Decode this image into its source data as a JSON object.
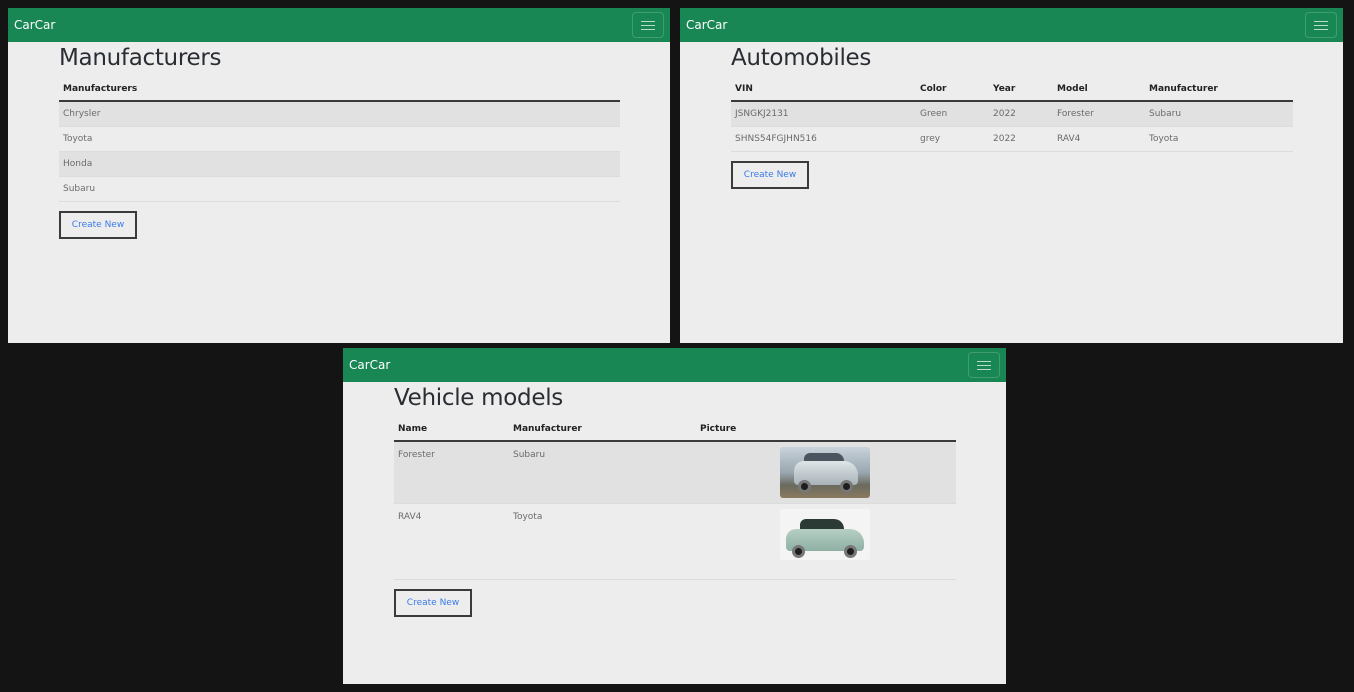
{
  "colors": {
    "navbar": "#198754",
    "page_bg": "#141414",
    "panel_bg": "#ededed",
    "link": "#3a7bea"
  },
  "brand": "CarCar",
  "manufacturers": {
    "title": "Manufacturers",
    "headers": [
      "Manufacturers"
    ],
    "rows": [
      "Chrysler",
      "Toyota",
      "Honda",
      "Subaru"
    ],
    "create_label": "Create New"
  },
  "automobiles": {
    "title": "Automobiles",
    "headers": [
      "VIN",
      "Color",
      "Year",
      "Model",
      "Manufacturer"
    ],
    "rows": [
      [
        "JSNGKJ2131",
        "Green",
        "2022",
        "Forester",
        "Subaru"
      ],
      [
        "SHNS54FGJHN516",
        "grey",
        "2022",
        "RAV4",
        "Toyota"
      ]
    ],
    "create_label": "Create New"
  },
  "models": {
    "title": "Vehicle models",
    "headers": [
      "Name",
      "Manufacturer",
      "Picture"
    ],
    "rows": [
      [
        "Forester",
        "Subaru",
        "forester-photo"
      ],
      [
        "RAV4",
        "Toyota",
        "rav4-photo"
      ]
    ],
    "create_label": "Create New"
  },
  "icons": {
    "menu": "hamburger-menu-icon"
  }
}
